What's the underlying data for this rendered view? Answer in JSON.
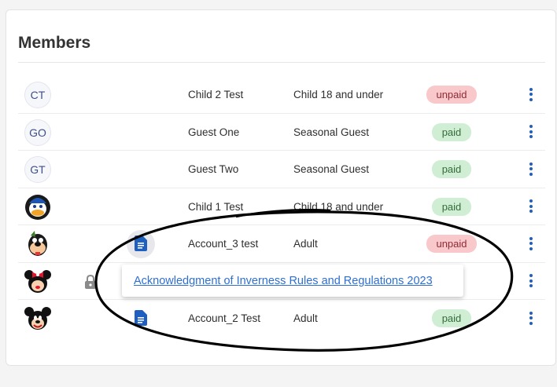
{
  "section_title": "Members",
  "members": [
    {
      "initials": "CT",
      "name": "Child 2 Test",
      "type": "Child 18 and under",
      "status": "unpaid",
      "avatar": "initials"
    },
    {
      "initials": "GO",
      "name": "Guest One",
      "type": "Seasonal Guest",
      "status": "paid",
      "avatar": "initials"
    },
    {
      "initials": "GT",
      "name": "Guest Two",
      "type": "Seasonal Guest",
      "status": "paid",
      "avatar": "initials"
    },
    {
      "initials": "",
      "name": "Child 1 Test",
      "type": "Child 18 and under",
      "status": "paid",
      "avatar": "donald-duck-icon"
    },
    {
      "initials": "",
      "name": "Account_3 test",
      "type": "Adult",
      "status": "unpaid",
      "avatar": "goofy-icon"
    },
    {
      "initials": "",
      "name": "",
      "type": "",
      "status": "",
      "avatar": "minnie-mouse-icon"
    },
    {
      "initials": "",
      "name": "Account_2 Test",
      "type": "Adult",
      "status": "paid",
      "avatar": "mickey-mouse-icon"
    }
  ],
  "popover": {
    "link_text": "Acknowledgment of Inverness Rules and Regulations 2023"
  },
  "colors": {
    "accent": "#1f5fbf",
    "paid_bg": "#cfeed3",
    "unpaid_bg": "#f8c8cb",
    "link": "#2f6fd0"
  }
}
